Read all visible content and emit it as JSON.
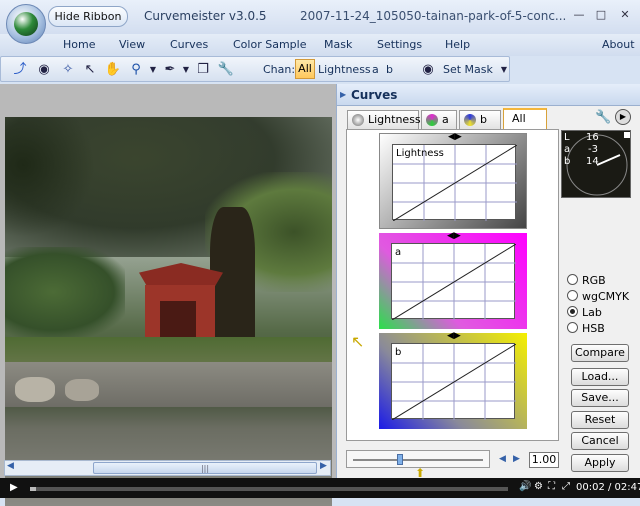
{
  "app": {
    "title": "Curvemeister v3.0.5",
    "file": "2007-11-24_105050-tainan-park-of-5-conc...",
    "hide_ribbon": "Hide Ribbon"
  },
  "menu": [
    "Home",
    "View",
    "Curves",
    "Color Sample",
    "Mask",
    "Settings",
    "Help"
  ],
  "menu_about": "About",
  "toolbar": {
    "chan_label": "Chan:",
    "chan_all": "All",
    "chan_lightness": "Lightness",
    "chan_a": "a",
    "chan_b": "b",
    "set_mask": "Set Mask"
  },
  "icons": [
    "curve-pencil-icon",
    "mask-icon",
    "magic-wand-icon",
    "pointer-icon",
    "hand-icon",
    "zoom-icon",
    "eyedropper-icon",
    "copy-icon",
    "wrench-icon"
  ],
  "curves": {
    "title": "Curves",
    "tabs": [
      "Lightness",
      "a",
      "b",
      "All"
    ],
    "active_tab": "All",
    "graphs": [
      "Lightness",
      "a",
      "b"
    ],
    "gauge": {
      "l": "L",
      "l_val": "16",
      "a": "a",
      "a_val": "-3",
      "b": "b",
      "b_val": "14"
    },
    "modes": [
      "RGB",
      "wgCMYK",
      "Lab",
      "HSB"
    ],
    "selected_mode": "Lab",
    "buttons": [
      "Compare",
      "Load...",
      "Save...",
      "Reset",
      "Cancel",
      "Apply"
    ],
    "zoom": "1.00"
  },
  "media": {
    "time": "00:02 / 02:47",
    "progress": 0.012
  }
}
